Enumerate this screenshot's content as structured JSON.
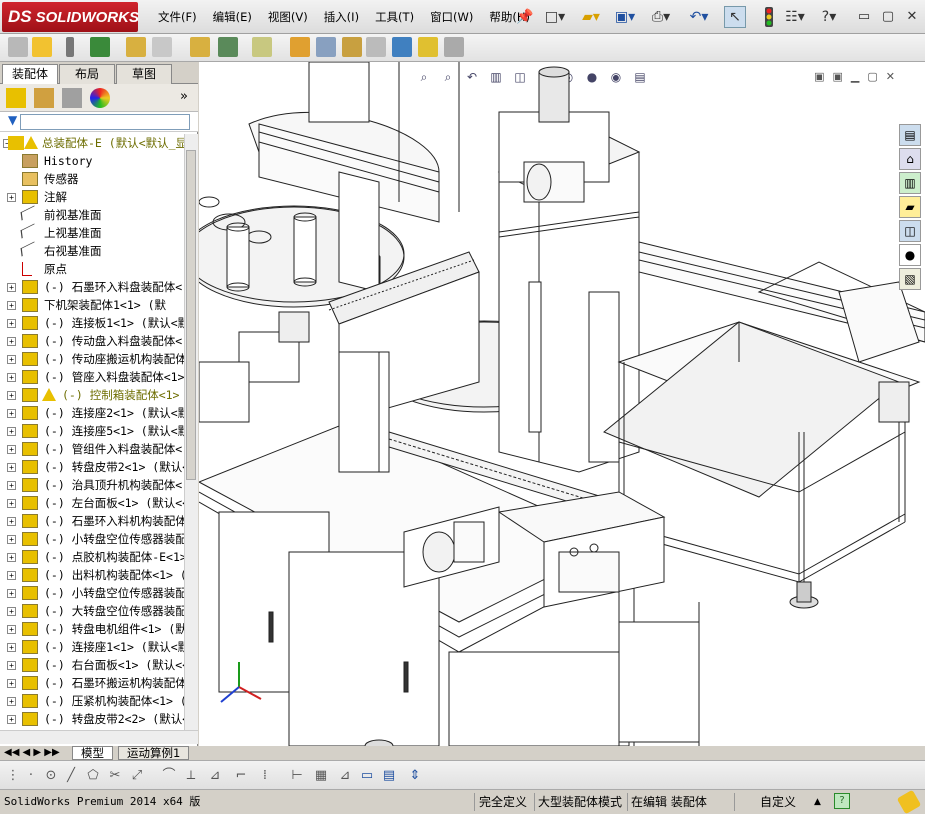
{
  "app": {
    "logo_prefix": "DS",
    "logo_text": "SOLIDWORKS"
  },
  "menu": [
    "文件(F)",
    "编辑(E)",
    "视图(V)",
    "插入(I)",
    "工具(T)",
    "窗口(W)",
    "帮助(H)"
  ],
  "titlebar_icons": [
    "pin-icon",
    "new-document-icon",
    "open-icon",
    "save-icon",
    "print-icon",
    "undo-icon",
    "select-arrow-icon",
    "traffic-light-icon",
    "options-icon",
    "help-icon"
  ],
  "window_controls": [
    "minimize-icon",
    "restore-icon",
    "close-icon"
  ],
  "panel_tabs": [
    "装配体",
    "布局",
    "草图"
  ],
  "tree": {
    "root": "总装配体-E  (默认<默认_显",
    "items": [
      {
        "label": "History",
        "expand": false,
        "icon": "history-icon",
        "style": "plain"
      },
      {
        "label": "传感器",
        "expand": false,
        "icon": "sensor-icon",
        "style": "plain"
      },
      {
        "label": "注解",
        "expand": true,
        "icon": "annotation-icon",
        "style": "plain"
      },
      {
        "label": "前视基准面",
        "expand": false,
        "icon": "plane-icon",
        "style": "plain"
      },
      {
        "label": "上视基准面",
        "expand": false,
        "icon": "plane-icon",
        "style": "plain"
      },
      {
        "label": "右视基准面",
        "expand": false,
        "icon": "plane-icon",
        "style": "plain"
      },
      {
        "label": "原点",
        "expand": false,
        "icon": "origin-icon",
        "style": "plain"
      },
      {
        "label": "(-) 石墨环入料盘装配体<",
        "expand": true,
        "icon": "assembly-icon",
        "style": "plain"
      },
      {
        "label": "下机架装配体1<1> (默",
        "expand": true,
        "icon": "assembly-icon",
        "style": "plain"
      },
      {
        "label": "(-) 连接板1<1> (默认<默",
        "expand": true,
        "icon": "part-icon",
        "style": "plain"
      },
      {
        "label": "(-) 传动盘入料盘装配体<",
        "expand": true,
        "icon": "assembly-icon",
        "style": "plain"
      },
      {
        "label": "(-) 传动座搬运机构装配体",
        "expand": true,
        "icon": "assembly-icon",
        "style": "plain"
      },
      {
        "label": "(-) 管座入料盘装配体<1>",
        "expand": true,
        "icon": "assembly-icon",
        "style": "plain"
      },
      {
        "label": "(-) 控制箱装配体<1>",
        "expand": true,
        "icon": "assembly-icon",
        "style": "warn"
      },
      {
        "label": "(-) 连接座2<1> (默认<默",
        "expand": true,
        "icon": "part-icon",
        "style": "plain"
      },
      {
        "label": "(-) 连接座5<1> (默认<默",
        "expand": true,
        "icon": "part-icon",
        "style": "plain"
      },
      {
        "label": "(-) 管组件入料盘装配体<",
        "expand": true,
        "icon": "assembly-icon",
        "style": "plain"
      },
      {
        "label": "(-) 转盘皮带2<1> (默认<",
        "expand": true,
        "icon": "part-icon",
        "style": "plain"
      },
      {
        "label": "(-) 治具顶升机构装配体<",
        "expand": true,
        "icon": "assembly-icon",
        "style": "plain"
      },
      {
        "label": "(-) 左台面板<1> (默认<<",
        "expand": true,
        "icon": "part-icon",
        "style": "plain"
      },
      {
        "label": "(-) 石墨环入料机构装配体",
        "expand": true,
        "icon": "assembly-icon",
        "style": "plain"
      },
      {
        "label": "(-) 小转盘空位传感器装配",
        "expand": true,
        "icon": "assembly-icon",
        "style": "plain"
      },
      {
        "label": "(-) 点胶机构装配体-E<1>",
        "expand": true,
        "icon": "assembly-icon",
        "style": "plain"
      },
      {
        "label": "(-) 出料机构装配体<1> (",
        "expand": true,
        "icon": "assembly-icon",
        "style": "plain"
      },
      {
        "label": "(-) 小转盘空位传感器装配",
        "expand": true,
        "icon": "assembly-icon",
        "style": "plain"
      },
      {
        "label": "(-) 大转盘空位传感器装配",
        "expand": true,
        "icon": "assembly-icon",
        "style": "plain"
      },
      {
        "label": "(-) 转盘电机组件<1> (默",
        "expand": true,
        "icon": "assembly-icon",
        "style": "plain"
      },
      {
        "label": "(-) 连接座1<1> (默认<默",
        "expand": true,
        "icon": "part-icon",
        "style": "plain"
      },
      {
        "label": "(-) 右台面板<1> (默认<<",
        "expand": true,
        "icon": "part-icon",
        "style": "plain"
      },
      {
        "label": "(-) 石墨环搬运机构装配体",
        "expand": true,
        "icon": "assembly-icon",
        "style": "plain"
      },
      {
        "label": "(-) 压紧机构装配体<1> (",
        "expand": true,
        "icon": "assembly-icon",
        "style": "plain"
      },
      {
        "label": "(-) 转盘皮带2<2> (默认<",
        "expand": true,
        "icon": "part-icon",
        "style": "plain"
      }
    ]
  },
  "bottom_tabs": [
    "模型",
    "运动算例1"
  ],
  "status": {
    "product": "SolidWorks Premium 2014 x64 版",
    "definition": "完全定义",
    "mode": "大型装配体模式",
    "editing": "在编辑 装配体",
    "units": "自定义"
  },
  "colors": {
    "logo_red": "#c0141c",
    "warning_yellow": "#e8c000",
    "folder_yellow": "#f2c230",
    "tree_warn_text": "#6d6d00"
  }
}
